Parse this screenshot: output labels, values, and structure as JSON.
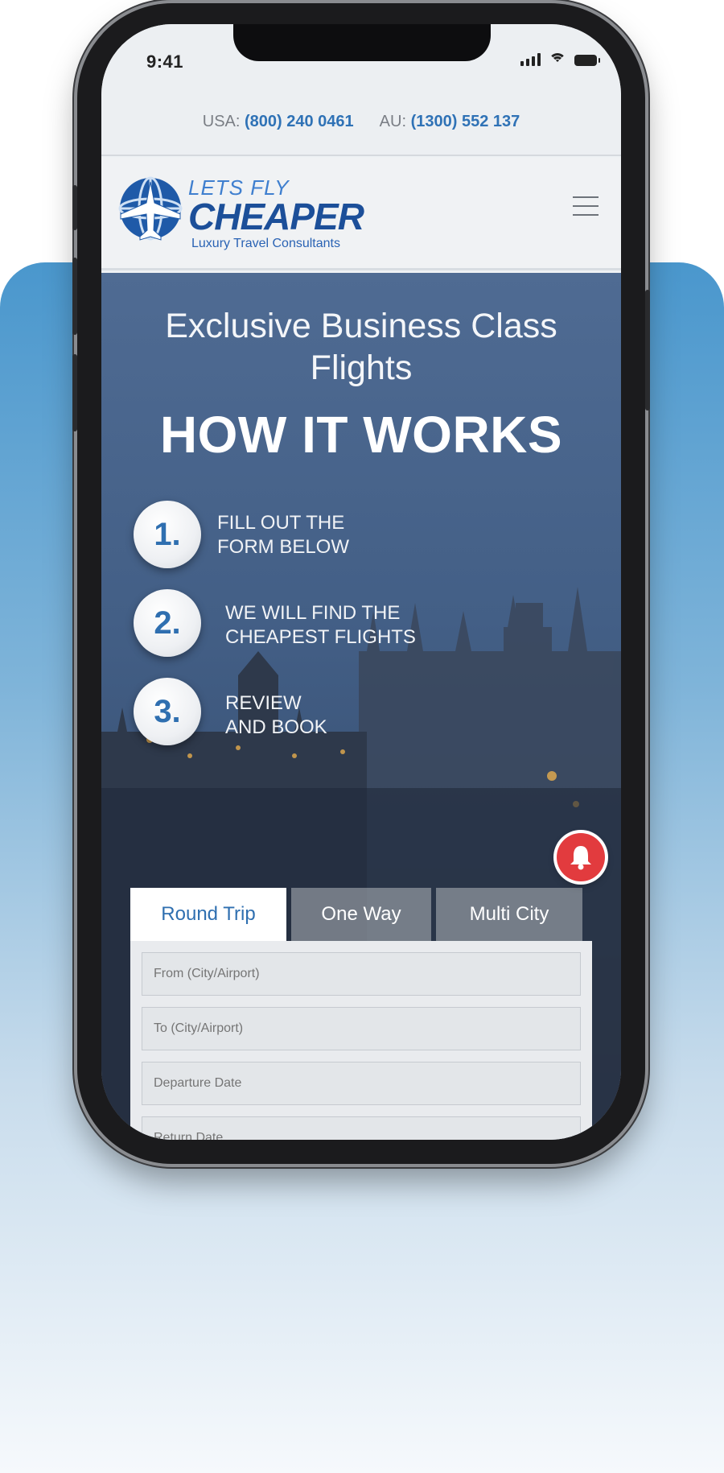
{
  "status_bar": {
    "time": "9:41"
  },
  "contact_strip": {
    "usa_label": "USA:",
    "usa_number": "(800) 240 0461",
    "au_label": "AU:",
    "au_number": "(1300) 552 137"
  },
  "header": {
    "logo_line1": "LETS FLY",
    "logo_line2": "CHEAPER",
    "logo_tagline": "Luxury Travel Consultants",
    "menu_icon": "hamburger-menu-icon"
  },
  "hero": {
    "title": "Exclusive Business Class Flights",
    "subtitle": "HOW IT WORKS",
    "steps": [
      {
        "number": "1.",
        "line1": "FILL OUT THE",
        "line2": "FORM BELOW"
      },
      {
        "number": "2.",
        "line1": "WE WILL FIND THE",
        "line2": "CHEAPEST FLIGHTS"
      },
      {
        "number": "3.",
        "line1": "REVIEW",
        "line2": "AND BOOK"
      }
    ]
  },
  "booking_form": {
    "tabs": [
      {
        "label": "Round Trip",
        "active": true
      },
      {
        "label": "One Way",
        "active": false
      },
      {
        "label": "Multi City",
        "active": false
      }
    ],
    "fields": {
      "from_placeholder": "From (City/Airport)",
      "to_placeholder": "To (City/Airport)",
      "departure_placeholder": "Departure Date",
      "return_placeholder": "Return Date"
    }
  },
  "notification_button": {
    "icon": "bell-icon",
    "color": "#e23b3e"
  },
  "colors": {
    "brand_blue": "#2f72b6",
    "background_gradient_top": "#4a97cd"
  }
}
